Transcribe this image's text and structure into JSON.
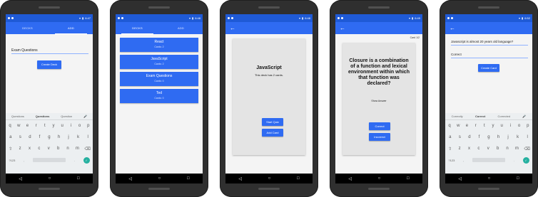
{
  "colors": {
    "primary": "#2f6bf2",
    "status_bar": "#1f5ad6",
    "background": "#f4f4f4"
  },
  "status_times": [
    "6:47",
    "6:48",
    "6:48",
    "6:49",
    "6:52"
  ],
  "icons": {
    "back": "arrow-left-icon",
    "mic": "mic-icon",
    "nav_back": "triangle-back-icon",
    "nav_home": "circle-home-icon",
    "nav_recents": "square-recents-icon"
  },
  "screen1": {
    "tab_decks": "DECKS",
    "tab_add": "ADD",
    "input_value": "Exam Questions",
    "create_button": "Create Deck",
    "suggestions": [
      "Questions",
      "Questions",
      "Question"
    ]
  },
  "screen2": {
    "tab_decks": "DECKS",
    "tab_add": "ADD",
    "decks": [
      {
        "title": "React",
        "subtitle": "Cards: 2"
      },
      {
        "title": "JavaScript",
        "subtitle": "Cards: 2"
      },
      {
        "title": "Exam Questions",
        "subtitle": "Cards: 0"
      },
      {
        "title": "Ted",
        "subtitle": "Cards: 0"
      }
    ]
  },
  "screen3": {
    "title": "JavaScript",
    "subtitle": "This deck has 2 cards.",
    "start_button": "Start Quiz",
    "add_button": "Add Card"
  },
  "screen4": {
    "progress": "Card 1/2",
    "question": "Closure is a combination of a function and lexical environment within which that function was declared?",
    "show_answer": "Show Answer",
    "correct_button": "Correct",
    "incorrect_button": "Incorrect"
  },
  "screen5": {
    "question_value": "Javascript is almost 20 years old language?",
    "answer_value": "Correct",
    "create_button": "Create Card",
    "suggestions": [
      "Correctly",
      "Correct",
      "Corrected"
    ]
  },
  "keyboard": {
    "row1": [
      "q",
      "w",
      "e",
      "r",
      "t",
      "y",
      "u",
      "i",
      "o",
      "p"
    ],
    "row2": [
      "a",
      "s",
      "d",
      "f",
      "g",
      "h",
      "j",
      "k",
      "l"
    ],
    "row3": [
      "⇧",
      "z",
      "x",
      "c",
      "v",
      "b",
      "n",
      "m",
      "⌫"
    ],
    "symbols_key": "?123",
    "comma": ",",
    "period": "."
  }
}
